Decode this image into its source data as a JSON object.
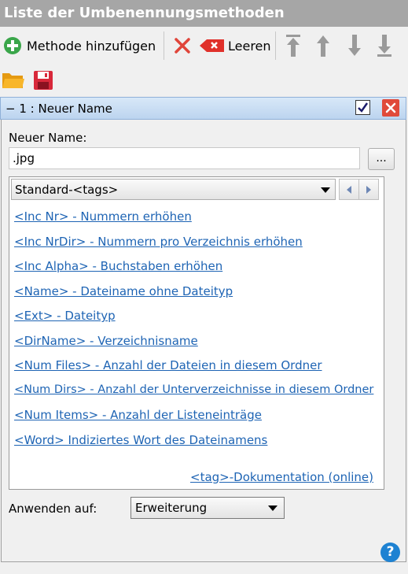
{
  "window": {
    "title": "Liste der Umbenennungsmethoden"
  },
  "toolbar": {
    "add_label": "Methode hinzufügen",
    "clear_label": "Leeren"
  },
  "panel": {
    "title": "1 : Neuer Name",
    "collapse_glyph": "−",
    "enabled": true,
    "new_name_label": "Neuer Name:",
    "new_name_value": ".jpg",
    "browse_label": "...",
    "tag_category": "Standard-<tags>",
    "tags": [
      "<Inc Nr> - Nummern erhöhen",
      "<Inc NrDir> - Nummern pro Verzeichnis erhöhen",
      "<Inc Alpha> - Buchstaben erhöhen",
      "<Name> - Dateiname ohne Dateityp",
      "<Ext> - Dateityp",
      "<DirName> - Verzeichnisname",
      "<Num Files> - Anzahl der Dateien in diesem Ordner",
      "<Num Dirs> - Anzahl der Unterverzeichnisse in diesem Ordner",
      "<Num Items> - Anzahl der Listeneinträge",
      "<Word> Indiziertes Wort des Dateinamens"
    ],
    "doc_link": "<tag>-Dokumentation (online)",
    "apply_label": "Anwenden auf:",
    "apply_value": "Erweiterung"
  },
  "help_label": "?",
  "colors": {
    "link": "#1e64b4",
    "title_bg": "#a6a6a6",
    "add_green": "#3aa64a",
    "delete_red": "#e0453a"
  }
}
